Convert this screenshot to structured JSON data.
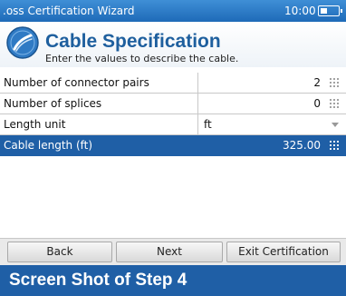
{
  "titlebar": {
    "title": ".oss Certification Wizard",
    "time": "10:00",
    "battery_icon": "battery-icon"
  },
  "header": {
    "icon": "fiber-cable-icon",
    "title": "Cable Specification",
    "subtitle": "Enter the values to describe the cable."
  },
  "fields": [
    {
      "label": "Number of connector pairs",
      "value": "2",
      "input": "keypad"
    },
    {
      "label": "Number of splices",
      "value": "0",
      "input": "keypad"
    },
    {
      "label": "Length unit",
      "value": "ft",
      "input": "dropdown"
    },
    {
      "label": "Cable length (ft)",
      "value": "325.00",
      "input": "keypad",
      "selected": true
    }
  ],
  "buttons": {
    "back": "Back",
    "next": "Next",
    "exit": "Exit Certification"
  },
  "caption": "Screen Shot of Step 4",
  "colors": {
    "accent": "#1f5fa6",
    "titlebar": "#2b7cc7",
    "header_title": "#1e5f9e"
  }
}
